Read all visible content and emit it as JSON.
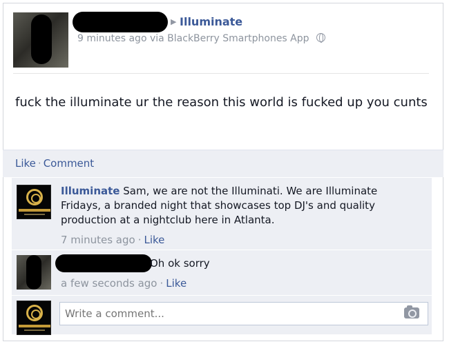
{
  "post": {
    "target_page": "Illuminate",
    "timestamp": "9 minutes ago",
    "via_text": "via BlackBerry Smartphones App",
    "body": "fuck the illuminate ur the reason this world is fucked up you cunts"
  },
  "actions": {
    "like_label": "Like",
    "separator": "·",
    "comment_label": "Comment"
  },
  "comments": [
    {
      "author": "Illuminate",
      "text": "Sam, we are not the Illuminati. We are Illuminate Fridays, a branded night that showcases top DJ's and quality production at a nightclub here in Atlanta.",
      "time": "7 minutes ago",
      "like_label": "Like"
    },
    {
      "text": "Oh ok sorry",
      "time": "a few seconds ago",
      "like_label": "Like"
    }
  ],
  "composer": {
    "placeholder": "Write a comment..."
  },
  "icons": {
    "globe": "globe-icon",
    "arrow": "right-arrow-icon",
    "camera": "camera-icon"
  },
  "colors": {
    "link": "#3b5998",
    "meta": "#8d949e",
    "comment_bg": "#edeff4"
  }
}
